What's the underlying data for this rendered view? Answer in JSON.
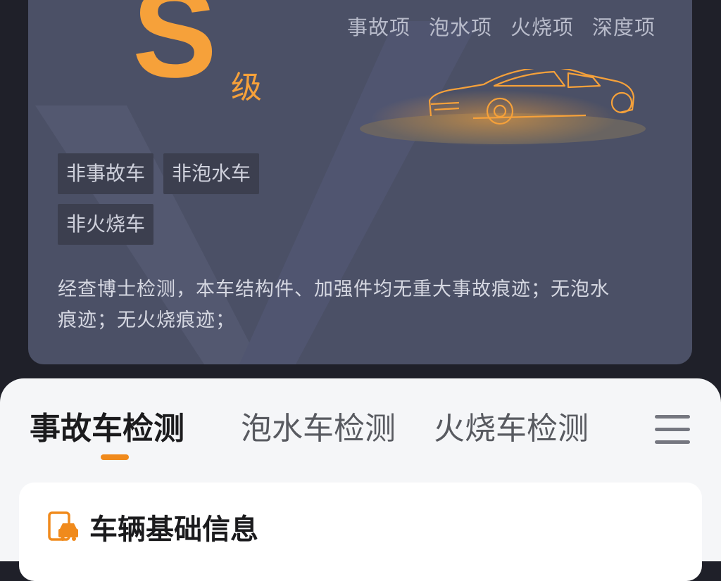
{
  "report": {
    "grade_letter": "S",
    "grade_suffix": "级",
    "check_items": [
      "事故项",
      "泡水项",
      "火烧项",
      "深度项"
    ],
    "tags": [
      "非事故车",
      "非泡水车",
      "非火烧车"
    ],
    "summary_line1": "经查博士检测，本车结构件、加强件均无重大事故痕迹；无泡水",
    "summary_line2": "痕迹；无火烧痕迹；"
  },
  "tabs": [
    "事故车检测",
    "泡水车检测",
    "火烧车检测"
  ],
  "active_tab": "事故车检测",
  "info_card": {
    "title": "车辆基础信息"
  },
  "colors": {
    "accent_orange": "#f6a13a",
    "card_bg": "#4b5066",
    "page_bg": "#1f2029",
    "sheet_bg": "#f5f6f8"
  },
  "icons": [
    "car-outline-icon",
    "menu-icon",
    "car-document-icon"
  ]
}
